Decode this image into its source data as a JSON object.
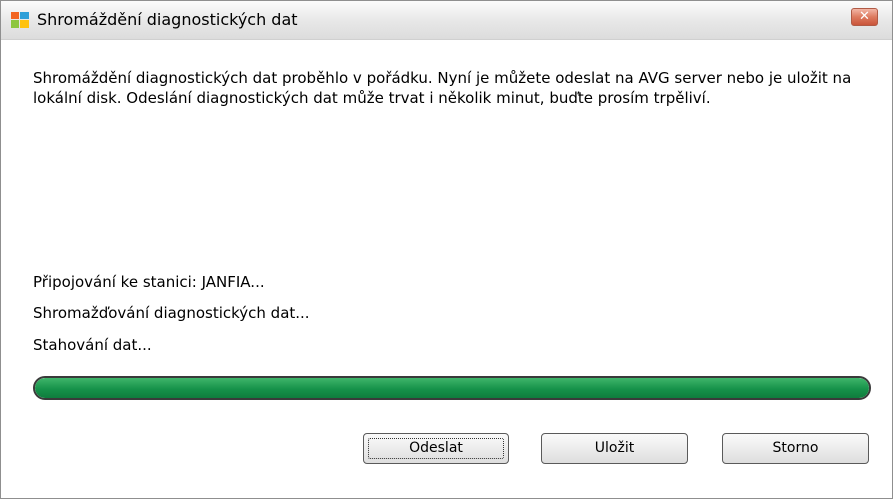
{
  "window": {
    "title": "Shromáždění diagnostických dat",
    "close_glyph": "✕",
    "app_icon": "avg-logo-icon"
  },
  "message": "Shromáždění diagnostických dat proběhlo v pořádku. Nyní je můžete odeslat na AVG server nebo je uložit na lokální disk. Odeslání diagnostických dat může trvat i několik minut, buďte prosím trpěliví.",
  "status_lines": [
    "Připojování ke stanici: JANFIA...",
    "Shromažďování diagnostických dat...",
    "Stahování dat..."
  ],
  "progress": {
    "value_percent": 100,
    "color": "#16924a"
  },
  "buttons": {
    "send": "Odeslat",
    "save": "Uložit",
    "cancel": "Storno"
  }
}
